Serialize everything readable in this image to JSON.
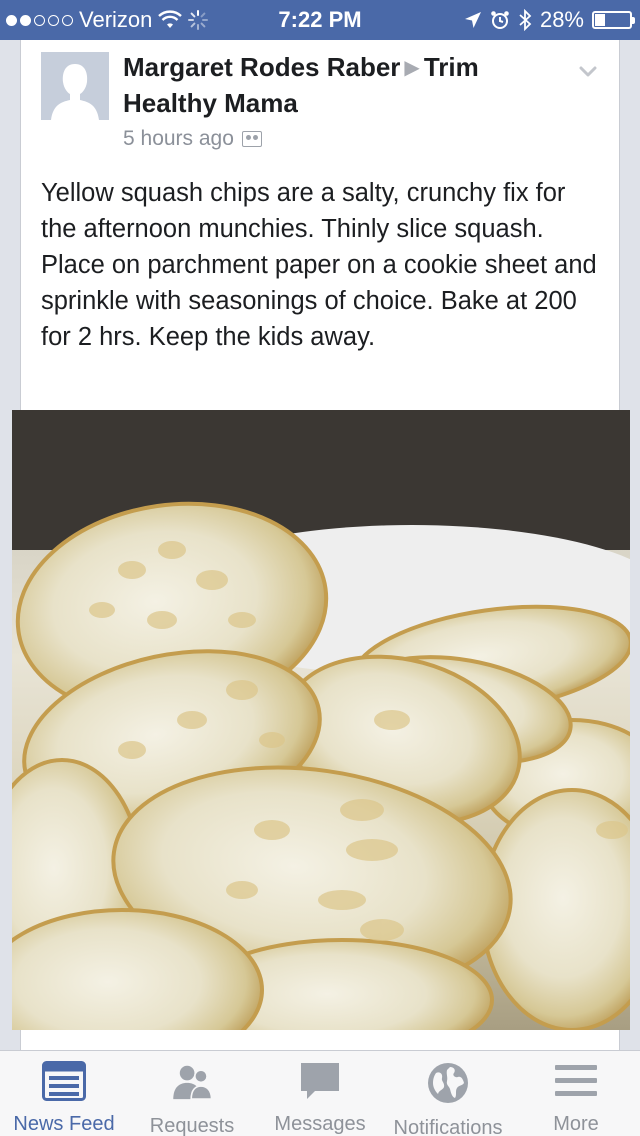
{
  "status_bar": {
    "carrier": "Verizon",
    "time": "7:22 PM",
    "battery": "28%",
    "battery_level": 0.28,
    "signal_bars_filled": 2,
    "signal_bars_total": 5
  },
  "post": {
    "author": "Margaret Rodes Raber",
    "target": "Trim Healthy Mama",
    "timestamp": "5 hours ago",
    "text": "Yellow squash chips are a salty, crunchy fix for the afternoon munchies.  Thinly slice squash. Place on parchment paper on a cookie sheet and sprinkle with seasonings of choice. Bake at 200 for 2 hrs.  Keep the kids away."
  },
  "tabs": [
    {
      "label": "News Feed",
      "icon": "news-feed-icon",
      "active": true
    },
    {
      "label": "Requests",
      "icon": "requests-icon",
      "active": false
    },
    {
      "label": "Messages",
      "icon": "messages-icon",
      "active": false
    },
    {
      "label": "Notifications",
      "icon": "notifications-icon",
      "active": false
    },
    {
      "label": "More",
      "icon": "more-icon",
      "active": false
    }
  ],
  "colors": {
    "brand": "#4a69a8",
    "inactive": "#8e9299"
  }
}
